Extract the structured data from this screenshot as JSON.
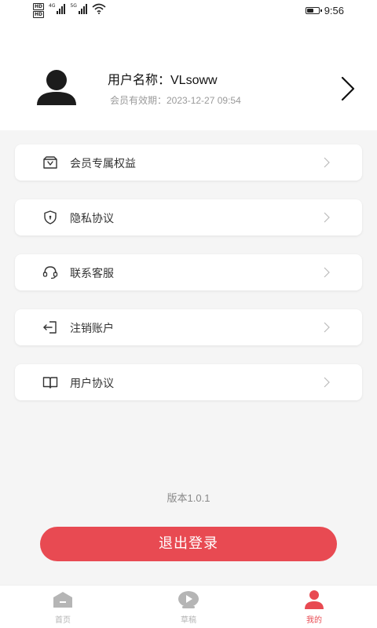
{
  "status_bar": {
    "time": "9:56",
    "hd_labels": [
      "HD",
      "HD"
    ],
    "network_1": "4G",
    "network_2": "5G",
    "battery_level": 0.6
  },
  "profile": {
    "user_name": "用户名称：VLsoww",
    "expire": "会员有效期：2023-12-27 09:54"
  },
  "menu": {
    "items": [
      {
        "label": "会员专属权益",
        "icon": "vip-box-icon"
      },
      {
        "label": "隐私协议",
        "icon": "shield-icon"
      },
      {
        "label": "联系客服",
        "icon": "headset-icon"
      },
      {
        "label": "注销账户",
        "icon": "logout-door-icon"
      },
      {
        "label": "用户协议",
        "icon": "book-icon"
      }
    ]
  },
  "version": "版本1.0.1",
  "logout_label": "退出登录",
  "tabbar": {
    "tabs": [
      {
        "label": "首页",
        "icon": "home-icon",
        "active": false
      },
      {
        "label": "草稿",
        "icon": "play-icon",
        "active": false
      },
      {
        "label": "我的",
        "icon": "user-icon",
        "active": true
      }
    ]
  },
  "colors": {
    "accent": "#e84a52",
    "inactive": "#b5b5b5"
  }
}
